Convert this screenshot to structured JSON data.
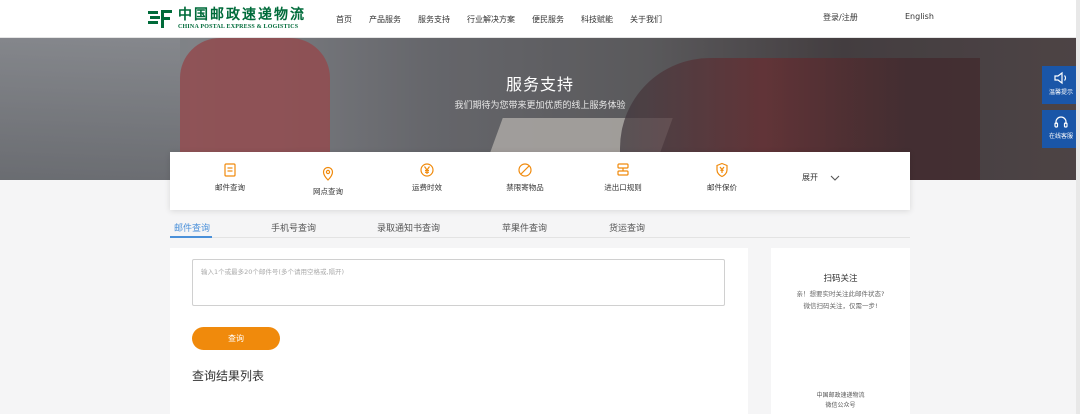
{
  "header": {
    "logo_cn": "中国邮政速递物流",
    "logo_en": "CHINA POSTAL EXPRESS & LOGISTICS",
    "nav": [
      "首页",
      "产品服务",
      "服务支持",
      "行业解决方案",
      "便民服务",
      "科技赋能",
      "关于我们"
    ],
    "login": "登录/注册",
    "language": "English"
  },
  "banner": {
    "title": "服务支持",
    "subtitle": "我们期待为您带来更加优质的线上服务体验"
  },
  "services": {
    "items": [
      {
        "label": "邮件查询",
        "icon": "receipt-icon"
      },
      {
        "label": "网点查询",
        "icon": "location-pin-icon"
      },
      {
        "label": "运费时效",
        "icon": "yuan-coin-icon"
      },
      {
        "label": "禁限寄物品",
        "icon": "prohibited-icon"
      },
      {
        "label": "进出口规则",
        "icon": "customs-icon"
      },
      {
        "label": "邮件保价",
        "icon": "shield-yuan-icon"
      }
    ],
    "expand_label": "展开",
    "accent_color": "#f08a0c"
  },
  "tabs": {
    "items": [
      "邮件查询",
      "手机号查询",
      "录取通知书查询",
      "苹果件查询",
      "货运查询"
    ],
    "active": "邮件查询"
  },
  "query": {
    "placeholder": "输入1个或最多20个邮件号(多个请用空格或,隔开)",
    "button": "查询",
    "result_title": "查询结果列表"
  },
  "qr": {
    "title": "扫码关注",
    "desc_line1": "亲！想要实时关注此邮件状态?",
    "desc_line2": "微信扫码关注，仅需一步!",
    "footer_line1": "中国邮政速递物流",
    "footer_line2": "微信公众号"
  },
  "float": {
    "notice": "温馨提示",
    "service": "在线客服"
  },
  "colors": {
    "brand_green": "#006b3a",
    "orange": "#f08a0c",
    "tab_blue": "#4a90d9",
    "float_blue": "#1a56a8"
  }
}
